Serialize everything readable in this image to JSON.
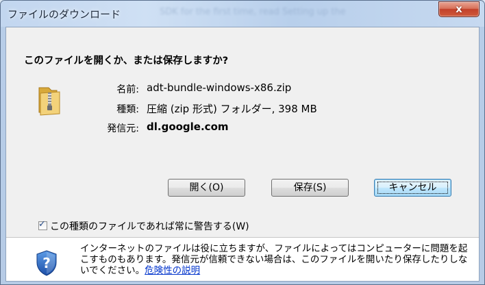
{
  "window": {
    "title": "ファイルのダウンロード",
    "background_ghost_text": "SDK for the first time, read Setting up the",
    "close_label": "x"
  },
  "dialog": {
    "question": "このファイルを開くか、または保存しますか?",
    "file_icon": "zip-folder-icon",
    "fields": {
      "name_label": "名前:",
      "name_value": "adt-bundle-windows-x86.zip",
      "type_label": "種類:",
      "type_value": "圧縮 (zip 形式) フォルダー, 398 MB",
      "from_label": "発信元:",
      "from_value": "dl.google.com"
    },
    "buttons": {
      "open": "開く(O)",
      "save": "保存(S)",
      "cancel": "キャンセル"
    },
    "checkbox": {
      "checked": true,
      "label": "この種類のファイルであれば常に警告する(W)"
    },
    "warning": {
      "icon": "shield-question-icon",
      "text": "インターネットのファイルは役に立ちますが、ファイルによってはコンピューターに問題を起こすものもあります。発信元が信頼できない場合は、このファイルを開いたり保存したりしないでください。",
      "link": "危険性の説明"
    }
  },
  "colors": {
    "accent": "#3c7fb1",
    "link": "#0033cc",
    "close": "#c2412a"
  }
}
